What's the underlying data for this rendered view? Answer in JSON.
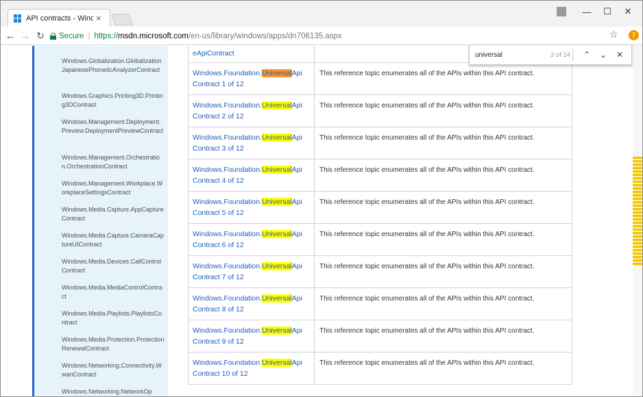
{
  "browser": {
    "tab_title": "API contracts - Windows",
    "tab_close": "×",
    "omnibox": {
      "secure_label": "Secure",
      "separator": "|",
      "scheme": "https://",
      "host": "msdn.microsoft.com",
      "path": "/en-us/library/windows/apps/dn706135.aspx"
    },
    "window_controls": {
      "minimize": "—",
      "maximize": "☐",
      "close": "✕"
    },
    "nav": {
      "back": "←",
      "forward": "→",
      "reload": "↻"
    },
    "bookmark_star": "☆",
    "extension_badge": "!",
    "accent_color": "#1f68c1"
  },
  "find_bar": {
    "query": "universal",
    "count": "3 of 24",
    "prev": "⌃",
    "next": "⌄",
    "close": "✕"
  },
  "sidebar": {
    "items": [
      "Windows.Globalization.GlobalizationJapanesePhoneticAnalyzerContract",
      "Windows.Graphics.Printing3D.Printing3DContract",
      "Windows.Management.Deployment.Preview.DeploymentPreviewContract",
      "Windows.Management.Orchestration.OrchestrationContract",
      "Windows.Management.Workplace.WorkplaceSettingsContract",
      "Windows.Media.Capture.AppCaptureContract",
      "Windows.Media.Capture.CameraCaptureUIContract",
      "Windows.Media.Devices.CallControlContract",
      "Windows.Media.MediaControlContract",
      "Windows.Media.Playlists.PlaylistsContract",
      "Windows.Media.Protection.ProtectionRenewalContract",
      "Windows.Networking.Connectivity.WwanContract",
      "Windows.Networking.NetworkOp"
    ]
  },
  "table": {
    "first_row_name": "eApiContract",
    "rows": [
      {
        "pre": "Windows.Foundation.",
        "match": "Universal",
        "post": "Api Contract 1 of 12",
        "desc": "This reference topic enumerates all of the APIs within this API contract."
      },
      {
        "pre": "Windows.Foundation.",
        "match": "Universal",
        "post": "Api Contract 2 of 12",
        "desc": "This reference topic enumerates all of the APIs within this API contract."
      },
      {
        "pre": "Windows.Foundation.",
        "match": "Universal",
        "post": "Api Contract 3 of 12",
        "desc": "This reference topic enumerates all of the APIs within this API contract."
      },
      {
        "pre": "Windows.Foundation.",
        "match": "Universal",
        "post": "Api Contract 4 of 12",
        "desc": "This reference topic enumerates all of the APIs within this API contract."
      },
      {
        "pre": "Windows.Foundation.",
        "match": "Universal",
        "post": "Api Contract 5 of 12",
        "desc": "This reference topic enumerates all of the APIs within this API contract."
      },
      {
        "pre": "Windows.Foundation.",
        "match": "Universal",
        "post": "Api Contract 6 of 12",
        "desc": "This reference topic enumerates all of the APIs within this API contract."
      },
      {
        "pre": "Windows.Foundation.",
        "match": "Universal",
        "post": "Api Contract 7 of 12",
        "desc": "This reference topic enumerates all of the APIs within this API contract."
      },
      {
        "pre": "Windows.Foundation.",
        "match": "Universal",
        "post": "Api Contract 8 of 12",
        "desc": "This reference topic enumerates all of the APIs within this API contract."
      },
      {
        "pre": "Windows.Foundation.",
        "match": "Universal",
        "post": "Api Contract 9 of 12",
        "desc": "This reference topic enumerates all of the APIs within this API contract."
      },
      {
        "pre": "Windows.Foundation.",
        "match": "Universal",
        "post": "Api Contract 10 of 12",
        "desc": "This reference topic enumerates all of the APIs within this API contract."
      }
    ]
  }
}
